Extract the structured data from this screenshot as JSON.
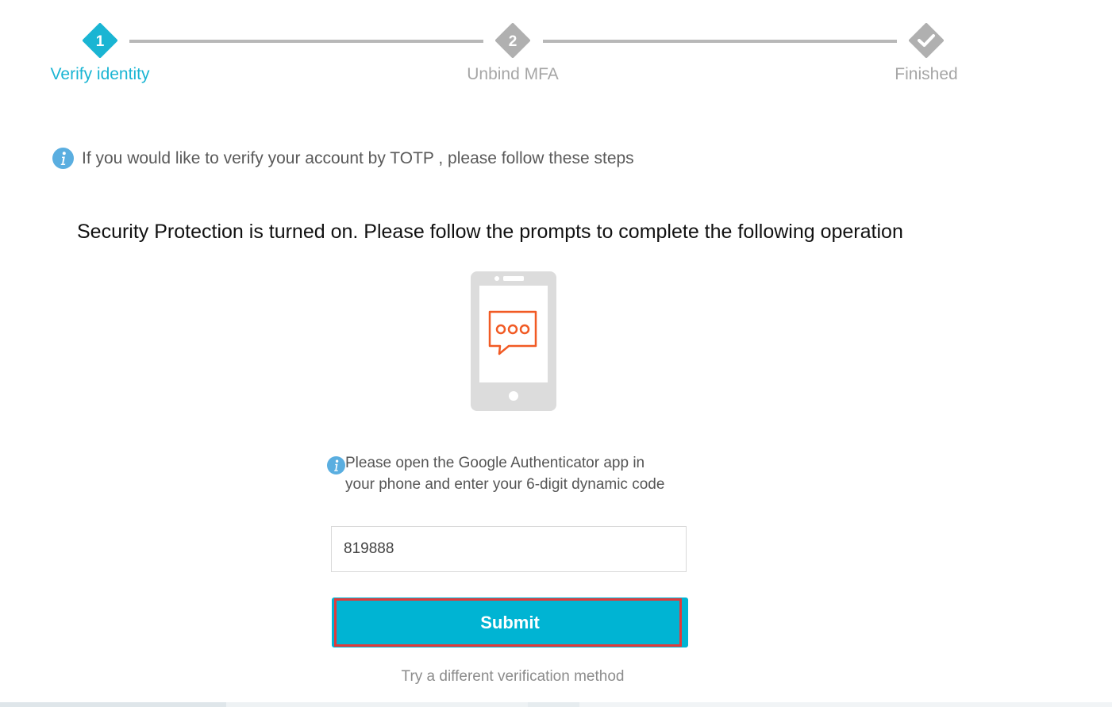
{
  "stepper": {
    "steps": [
      {
        "number": "1",
        "label": "Verify identity",
        "state": "active"
      },
      {
        "number": "2",
        "label": "Unbind MFA",
        "state": "pending"
      },
      {
        "number": "",
        "label": "Finished",
        "state": "pending",
        "icon": "checkmark-icon"
      }
    ],
    "colors": {
      "active": "#1ab5d3",
      "inactive": "#b8b8b8"
    }
  },
  "notice": {
    "icon": "info-icon",
    "text": "If you would like to verify your account by TOTP , please follow these steps"
  },
  "headline": "Security Protection is turned on. Please follow the prompts to complete the following operation",
  "illustration": {
    "icon": "phone-message-icon",
    "accent_color": "#f15a24"
  },
  "form": {
    "hint_icon": "info-icon",
    "hint": "Please open the Google Authenticator app in your phone and enter your 6-digit dynamic code",
    "code_value": "819888",
    "submit_label": "Submit",
    "submit_color": "#00b4d3",
    "alt_method_label": "Try a different verification method"
  }
}
